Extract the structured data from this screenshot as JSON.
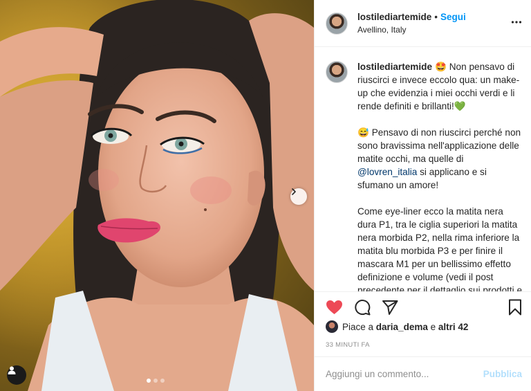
{
  "post": {
    "username": "lostilediartemide",
    "follow_label": "Segui",
    "separator": "•",
    "location": "Avellino, Italy"
  },
  "caption": {
    "username": "lostilediartemide",
    "p1": "🤩 Non pensavo di riuscirci e invece eccolo qua: un make-up che evidenzia i miei occhi verdi e li rende definiti e brillanti!💚",
    "p2_before": "😅 Pensavo di non riuscirci perché non sono bravissima nell'applicazione delle matite occhi, ma quelle di ",
    "p2_mention": "@lovren_italia",
    "p2_after": " si applicano e si sfumano un amore!",
    "p3": "Come eye-liner ecco la matita nera dura P1, tra le ciglia superiori la matita nera morbida P2, nella rima inferiore la matita blu morbida P3 e per finire il mascara M1 per un bellissimo effetto definizione e volume (vedi il post precedente per il dettaglio sui prodotti e le Stories in evidenza “Lovren Italia”)"
  },
  "icons": {
    "like": "heart-filled-icon",
    "comment": "comment-bubble-icon",
    "share": "paper-plane-icon",
    "save": "bookmark-icon",
    "more": "ellipsis-icon",
    "next": "chevron-right-icon",
    "tag": "user-tag-icon"
  },
  "likes": {
    "prefix": "Piace a",
    "user": "daria_dema",
    "connector": "e",
    "others": "altri 42"
  },
  "timestamp": "33 MINUTI FA",
  "comment": {
    "placeholder": "Aggiungi un commento...",
    "publish_label": "Pubblica"
  },
  "carousel": {
    "count": 3,
    "active_index": 0
  },
  "colors": {
    "accent": "#0095f6",
    "like_red": "#ed4956",
    "publish_disabled": "#b2dffc",
    "mention": "#00376b",
    "muted": "#8e8e8e"
  }
}
